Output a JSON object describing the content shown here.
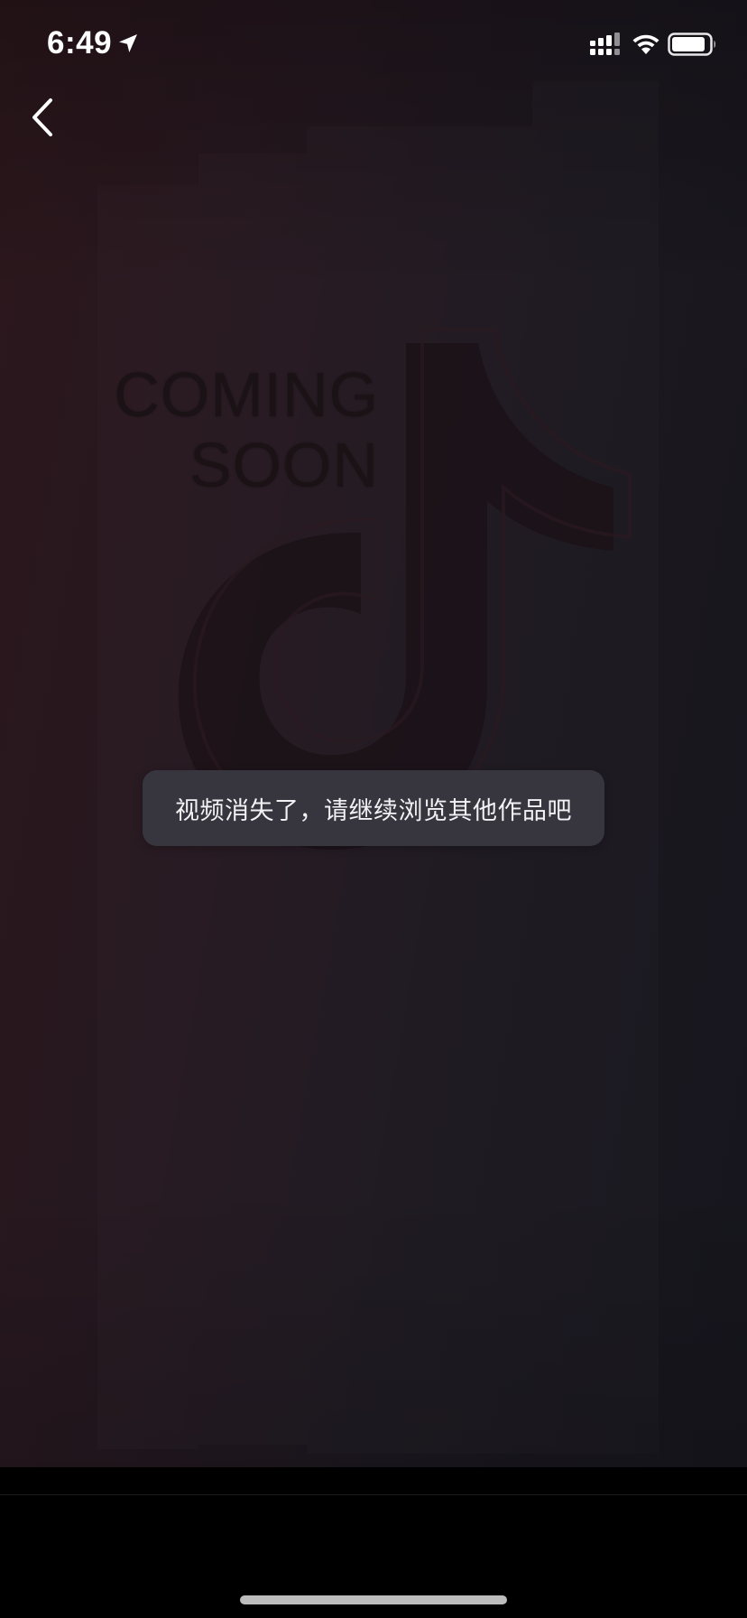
{
  "status_bar": {
    "time": "6:49",
    "icons": [
      "location-arrow-icon",
      "cellular-signal-icon",
      "wifi-icon",
      "battery-icon"
    ]
  },
  "navigation": {
    "back_icon": "chevron-left-icon"
  },
  "poster": {
    "line1": "COMING",
    "line2": "SOON"
  },
  "toast": {
    "message": "视频消失了，请继续浏览其他作品吧"
  },
  "colors": {
    "background_left": "#2c171c",
    "background_right": "#16161d",
    "toast_background": "#37363f",
    "toast_text": "#f2f2f4",
    "home_indicator": "#bdbdbd"
  }
}
